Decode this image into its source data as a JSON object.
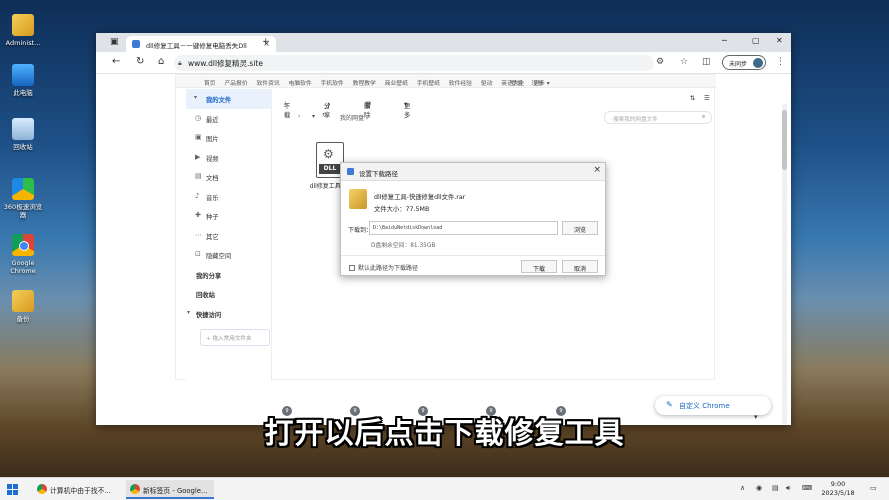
{
  "desktop": {
    "icons": [
      {
        "label": "Administ..."
      },
      {
        "label": "此电脑"
      },
      {
        "label": "回收站"
      },
      {
        "label": "360极速浏览器"
      },
      {
        "label": "Google Chrome"
      },
      {
        "label": "备份"
      }
    ]
  },
  "browser": {
    "tab_title": "dll修复工具－一键修复电脑丢失Dll",
    "tab_close": "×",
    "new_tab": "+",
    "url": "www.dll修复精灵.site",
    "profile_label": "未同步",
    "win_controls": {
      "min": "─",
      "max": "▢",
      "close": "✕"
    }
  },
  "site": {
    "topnav": [
      "首页",
      "产品报价",
      "软件资讯",
      "电脑软件",
      "手机软件",
      "教程教学",
      "商业壁纸",
      "手机壁纸",
      "软件经验",
      "驱动",
      "英语大全",
      "更多 ▾"
    ],
    "topnav_right": [
      "登录",
      "注册"
    ]
  },
  "sidebar": {
    "my_files": "我的文件",
    "items": [
      {
        "label": "最近",
        "icon": "clock-icon",
        "glyph": "◷"
      },
      {
        "label": "图片",
        "icon": "image-icon",
        "glyph": "▣"
      },
      {
        "label": "视频",
        "icon": "video-icon",
        "glyph": "▶"
      },
      {
        "label": "文档",
        "icon": "document-icon",
        "glyph": "▤"
      },
      {
        "label": "音乐",
        "icon": "music-icon",
        "glyph": "♪"
      },
      {
        "label": "种子",
        "icon": "seed-icon",
        "glyph": "✚"
      },
      {
        "label": "其它",
        "icon": "more-icon",
        "glyph": "⋯"
      },
      {
        "label": "隐藏空间",
        "icon": "lock-icon",
        "glyph": "⊡"
      }
    ],
    "my_share": "我的分享",
    "recycle": "回收站",
    "quick_access": "快捷访问",
    "add_common": "+ 拖入常用文件夹"
  },
  "toolbar": {
    "download": "下载",
    "share": "分享",
    "delete": "删除",
    "more": "更多"
  },
  "pathbar": {
    "crumb": "我的网盘",
    "search_placeholder": "搜索我的网盘文件"
  },
  "file": {
    "badge": "DLL",
    "name": "dll修复工具.r..."
  },
  "dialog": {
    "title": "设置下载路径",
    "close": "×",
    "file_name": "dll修复工具-快速修复dll文件.rar",
    "file_size": "文件大小：77.5MB",
    "download_to_label": "下载到：",
    "path_value": "D:\\BaiduNetdiskDownload",
    "browse": "浏览",
    "free_space": "D盘剩余空间：81.35GB",
    "default_checkbox": "默认此路径为下载路径",
    "download_btn": "下载",
    "cancel_btn": "取消"
  },
  "newtab": {
    "shortcuts": [
      "9",
      "9",
      "9",
      "9",
      "9"
    ],
    "customize": "自定义 Chrome"
  },
  "subtitle": "打开以后点击下载修复工具",
  "taskbar": {
    "tasks": [
      {
        "label": "计算机中由于找不..."
      },
      {
        "label": "新标签页 - Google..."
      }
    ],
    "time": "9:00",
    "date": "2023/5/18"
  },
  "colors": {
    "accent": "#1a66c7",
    "taskbar_active": "#3a77d0"
  }
}
